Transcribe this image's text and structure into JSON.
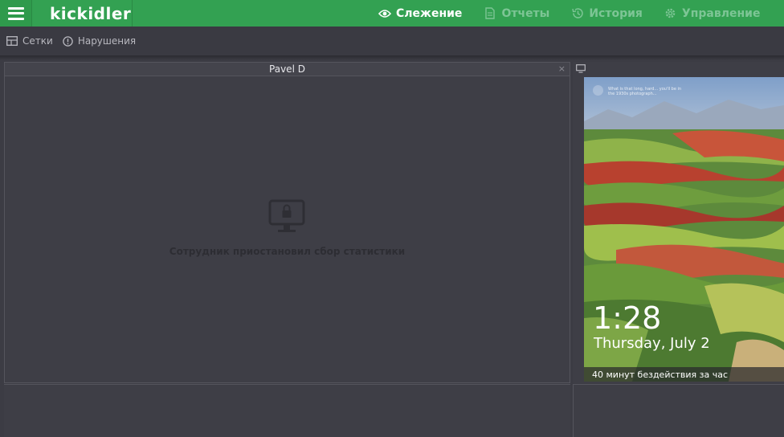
{
  "header": {
    "logo": "kickidler",
    "nav": [
      {
        "label": "Слежение",
        "icon": "eye-icon",
        "active": true
      },
      {
        "label": "Отчеты",
        "icon": "document-icon",
        "active": false
      },
      {
        "label": "История",
        "icon": "history-icon",
        "active": false
      },
      {
        "label": "Управление",
        "icon": "gear-icon",
        "active": false
      }
    ]
  },
  "toolbar": {
    "grids_label": "Сетки",
    "violations_label": "Нарушения"
  },
  "main_panel": {
    "title": "Pavel D",
    "close": "×",
    "status_text": "Сотрудник приостановил сбор статистики"
  },
  "side_panel": {
    "lock_time": "1:28",
    "lock_date": "Thursday, July 2",
    "caption": "40 минут бездействия за час",
    "tip": "What is that long, hard... you'll be in the 1930s photograph..."
  },
  "colors": {
    "brand_green": "#33a152",
    "background": "#3c3c44"
  }
}
